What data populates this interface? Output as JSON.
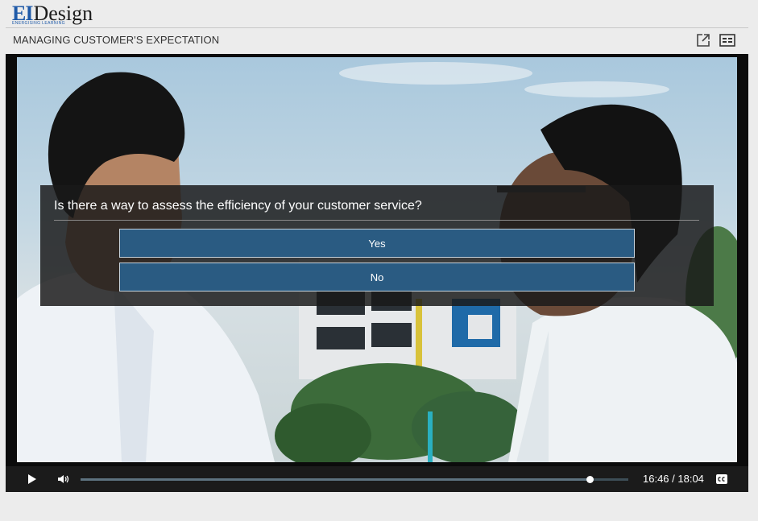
{
  "brand": {
    "logo_ei": "EI",
    "logo_design": "Design",
    "tagline": "ENERGISING LEARNING"
  },
  "header": {
    "title": "MANAGING CUSTOMER'S EXPECTATION",
    "icons": [
      "popout-icon",
      "menu-icon"
    ]
  },
  "quiz": {
    "question": "Is there a way to assess the efficiency of your customer service?",
    "answers": [
      "Yes",
      "No"
    ]
  },
  "player": {
    "time_display": "16:46 / 18:04",
    "progress": 0.9299,
    "icons": [
      "play-icon",
      "volume-icon",
      "closed-captions-icon"
    ]
  },
  "colors": {
    "background": "#ececec",
    "quiz_button": "#2a5b82",
    "controls_bar": "#1b1b1b",
    "logo_blue": "#1f5aa8"
  }
}
